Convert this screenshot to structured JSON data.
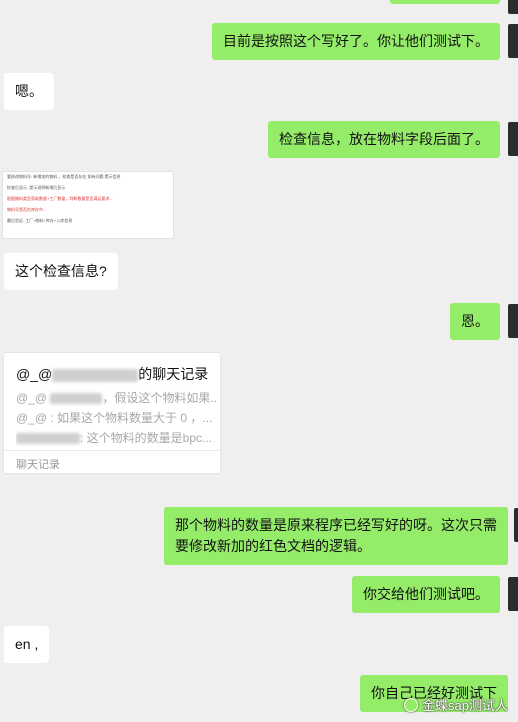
{
  "messages": [
    {
      "id": "m1",
      "text": "目前是按照这个写好了。你让他们测试下。"
    },
    {
      "id": "m2",
      "text": "嗯。"
    },
    {
      "id": "m3",
      "text": "检查信息，放在物料字段后面了。"
    },
    {
      "id": "m4",
      "text": "这个检查信息?"
    },
    {
      "id": "m5",
      "text": "恩。"
    },
    {
      "id": "m6",
      "text": "那个物料的数量是原来程序已经写好的呀。这次只需要修改新加的红色文档的逻辑。"
    },
    {
      "id": "m7",
      "text": "你交给他们测试吧。"
    },
    {
      "id": "m8",
      "text": "en ,"
    },
    {
      "id": "m9",
      "text": "你自己已经好测试下"
    }
  ],
  "screenshot_thumb": {
    "lines": [
      "要修改物料号: 新增加的物料 ，检查是否存在 如有问题 提示信息",
      "检查后显示, 提示说明新增后显示",
      "根据物料类型获取数量+工厂数量，判断数量是否满足要求...",
      "物料号是否在库存中...",
      "最后验证: 工厂+物料+库存+入库信息"
    ]
  },
  "chat_history": {
    "title_prefix": "@_@",
    "title_suffix": "的聊天记录",
    "line1_prefix": "@_@",
    "line1_text": "，假设这个物料如果...",
    "line2_text": "@_@ : 如果这个物料数量大于 0 ，...",
    "line3_text": ": 这个物料的数量是bpc...",
    "footer": "聊天记录"
  },
  "watermark": "金蝶sap测试人"
}
